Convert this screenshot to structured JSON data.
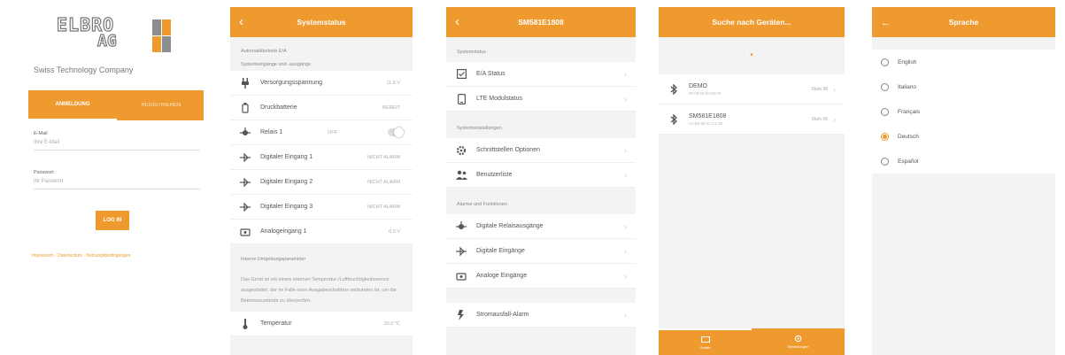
{
  "colors": {
    "accent": "#ee9a2f",
    "background": "#f3f3f3"
  },
  "login": {
    "logo_row1": "ELBRO",
    "logo_row2": "AG",
    "tagline": "Swiss Technology Company",
    "tabs": [
      "ANMELDUNG",
      "REGISTRIEREN"
    ],
    "email_label": "E-Mail",
    "email_value": "Ihre E-Mail",
    "password_label": "Passwort",
    "password_value": "Ihr Passwort",
    "login_button": "LOG IN",
    "links": "Impressum · Datenschutz · Nutzungsbedingungen"
  },
  "system": {
    "title": "Systemstatus",
    "section1": "Automatikbetrieb E/A",
    "section1b": "Systemeingänge und -ausgänge",
    "rows": [
      {
        "icon": "plug-icon",
        "label": "Versorgungsspannung",
        "status": "11.6 V"
      },
      {
        "icon": "pressure-icon",
        "label": "Druckbatterie",
        "status": "BEREIT"
      },
      {
        "icon": "relay-icon",
        "label": "Relais 1",
        "status": "OFF",
        "toggle": true
      },
      {
        "icon": "input-icon",
        "label": "Digitaler Eingang 1",
        "status": "NICHT ALARM"
      },
      {
        "icon": "input-icon",
        "label": "Digitaler Eingang 2",
        "status": "NICHT ALARM"
      },
      {
        "icon": "input-icon",
        "label": "Digitaler Eingang 3",
        "status": "NICHT ALARM"
      },
      {
        "icon": "analog-icon",
        "label": "Analogeingang 1",
        "status": "0.0 V"
      }
    ],
    "section2": "Interne Umgebungsparameter",
    "note": "Das Gerät ist mit einem internen Temperatur-/Luftfeuchtigkeitssensor ausgestattet, der im Falle einer Ausgabeschaltbox verbunden ist, um die Betriebszustände zu überprüfen.",
    "last_row": {
      "icon": "thermometer-icon",
      "label": "Temperatur",
      "status": "20.0 °C"
    }
  },
  "device": {
    "title": "SM581E1808",
    "section1": "Systemstatus",
    "rows1": [
      {
        "icon": "io-icon",
        "label": "E/A Status"
      },
      {
        "icon": "phone-icon",
        "label": "LTE Modulstatus"
      }
    ],
    "section2": "Systemeinstellungen",
    "rows2": [
      {
        "icon": "gear-icon",
        "label": "Schnittstellen Optionen"
      },
      {
        "icon": "users-icon",
        "label": "Benutzerliste"
      }
    ],
    "section3": "Alarme und Funktionen",
    "rows3": [
      {
        "icon": "relay-icon",
        "label": "Digitale Relaisausgänge"
      },
      {
        "icon": "input-icon",
        "label": "Digitale Eingänge"
      },
      {
        "icon": "analog-icon",
        "label": "Analoge Eingänge"
      }
    ],
    "rows4": [
      {
        "icon": "power-icon",
        "label": "Stromausfall-Alarm"
      }
    ]
  },
  "search": {
    "title": "Suche nach Geräten...",
    "devices": [
      {
        "name": "DEMO",
        "id": "00:00:00:00:00:00",
        "signal": "Stark 98"
      },
      {
        "name": "SM581E1808",
        "id": "A4:B8:98:41:C1:3E",
        "signal": "Stark 96"
      }
    ],
    "nav": [
      "Geräte",
      "Einstellungen"
    ]
  },
  "language": {
    "title": "Sprache",
    "options": [
      "English",
      "Italiano",
      "Français",
      "Deutsch",
      "Español"
    ],
    "selected": "Deutsch"
  }
}
